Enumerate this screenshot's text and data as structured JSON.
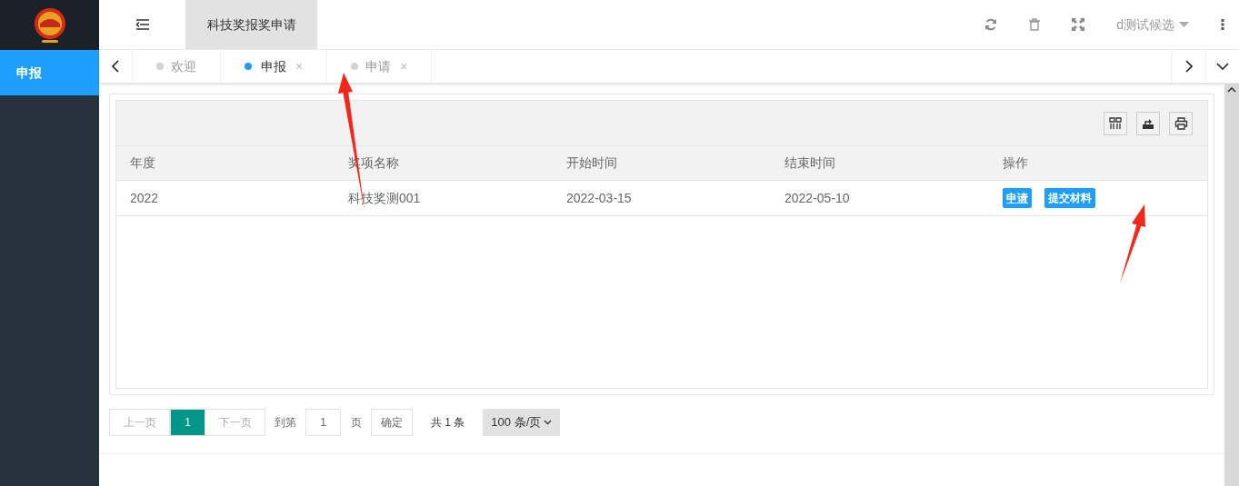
{
  "sidebar": {
    "items": [
      {
        "label": "申报",
        "selected": true
      }
    ]
  },
  "header": {
    "title_tab": "科技奖报奖申请",
    "user": "d测试候选"
  },
  "tabs": [
    {
      "label": "欢迎",
      "selected": false,
      "closable": false
    },
    {
      "label": "申报",
      "selected": true,
      "closable": true
    },
    {
      "label": "申请",
      "selected": false,
      "closable": true
    }
  ],
  "close_glyph": "×",
  "table": {
    "columns": [
      "年度",
      "奖项名称",
      "开始时间",
      "结束时间",
      "操作"
    ],
    "rows": [
      {
        "cells": [
          "2022",
          "科技奖测001",
          "2022-03-15",
          "2022-05-10"
        ],
        "actions": [
          "申请",
          "提交材料"
        ]
      }
    ]
  },
  "pagination": {
    "prev": "上一页",
    "pages": [
      {
        "label": "1",
        "selected": true
      }
    ],
    "next": "下一页",
    "goto_label": "到第",
    "goto_value": "1",
    "page_unit": "页",
    "confirm": "确定",
    "total": "共 1 条",
    "page_size": "100 条/页"
  }
}
